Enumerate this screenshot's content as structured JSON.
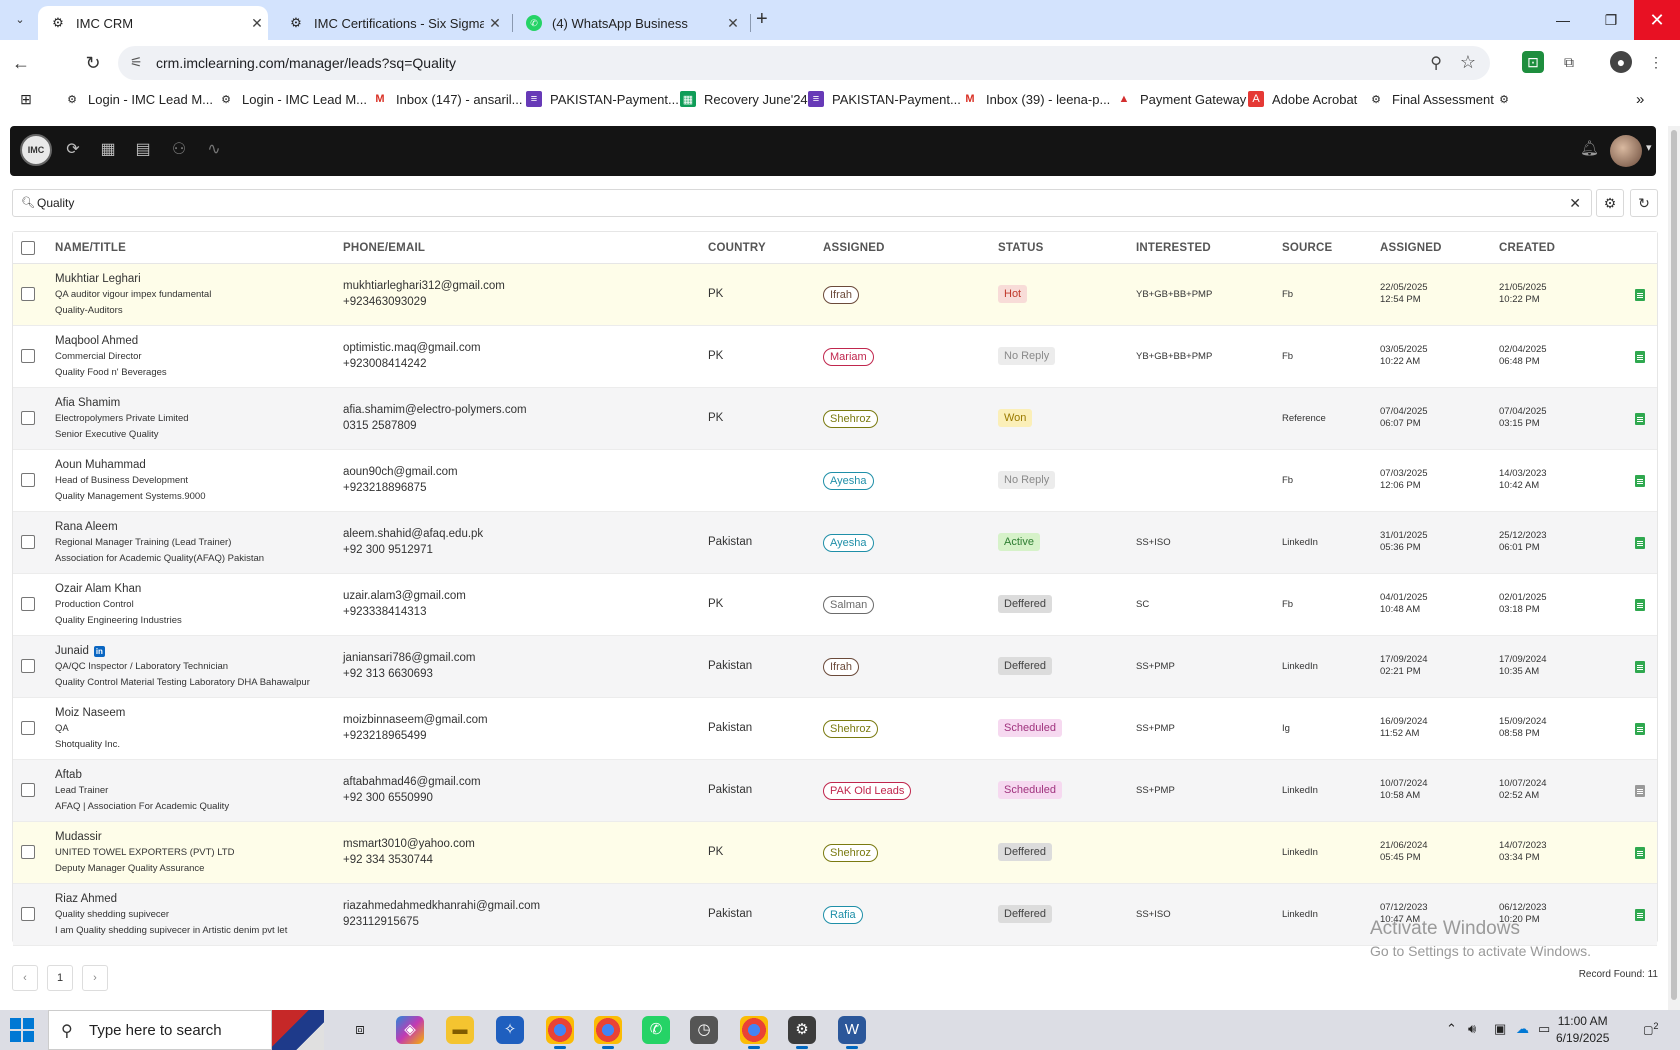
{
  "browser": {
    "tabs": [
      {
        "title": "IMC CRM",
        "active": true
      },
      {
        "title": "IMC Certifications - Six Sigma G",
        "active": false
      },
      {
        "title": "(4) WhatsApp Business",
        "active": false
      }
    ],
    "url": "crm.imclearning.com/manager/leads?sq=Quality",
    "bookmarks": [
      "Login - IMC Lead M...",
      "Login - IMC Lead M...",
      "Inbox (147) - ansaril...",
      "PAKISTAN-Payment...",
      "Recovery June'24",
      "PAKISTAN-Payment...",
      "Inbox (39) - leena-p...",
      "Payment Gateway",
      "Adobe Acrobat",
      "Final Assessment"
    ]
  },
  "search": {
    "value": "Quality"
  },
  "table": {
    "headers": [
      "NAME/TITLE",
      "PHONE/EMAIL",
      "COUNTRY",
      "ASSIGNED",
      "STATUS",
      "INTERESTED",
      "SOURCE",
      "ASSIGNED",
      "CREATED"
    ],
    "rows": [
      {
        "name": "Mukhtiar Leghari",
        "title": "QA auditor vigour impex fundamental",
        "company": "Quality-Auditors",
        "email": "mukhtiarleghari312@gmail.com",
        "phone": "+923463093029",
        "country": "PK",
        "assigned": "Ifrah",
        "status": "Hot",
        "interested": "YB+GB+BB+PMP",
        "source": "Fb",
        "assigned_date": "22/05/2025",
        "assigned_time": "12:54 PM",
        "created_date": "21/05/2025",
        "created_time": "10:22 PM"
      },
      {
        "name": "Maqbool Ahmed",
        "title": "Commercial Director",
        "company": "Quality Food n' Beverages",
        "email": "optimistic.maq@gmail.com",
        "phone": "+923008414242",
        "country": "PK",
        "assigned": "Mariam",
        "status": "No Reply",
        "interested": "YB+GB+BB+PMP",
        "source": "Fb",
        "assigned_date": "03/05/2025",
        "assigned_time": "10:22 AM",
        "created_date": "02/04/2025",
        "created_time": "06:48 PM"
      },
      {
        "name": "Afia Shamim",
        "title": "Electropolymers Private Limited",
        "company": "Senior Executive Quality",
        "email": "afia.shamim@electro-polymers.com",
        "phone": "0315 2587809",
        "country": "PK",
        "assigned": "Shehroz",
        "status": "Won",
        "interested": "",
        "source": "Reference",
        "assigned_date": "07/04/2025",
        "assigned_time": "06:07 PM",
        "created_date": "07/04/2025",
        "created_time": "03:15 PM"
      },
      {
        "name": "Aoun Muhammad",
        "title": "Head of Business Development",
        "company": "Quality Management Systems.9000",
        "email": "aoun90ch@gmail.com",
        "phone": "+923218896875",
        "country": "",
        "assigned": "Ayesha",
        "status": "No Reply",
        "interested": "",
        "source": "Fb",
        "assigned_date": "07/03/2025",
        "assigned_time": "12:06 PM",
        "created_date": "14/03/2023",
        "created_time": "10:42 AM"
      },
      {
        "name": "Rana Aleem",
        "title": "Regional Manager Training (Lead Trainer)",
        "company": "Association for Academic Quality(AFAQ) Pakistan",
        "email": "aleem.shahid@afaq.edu.pk",
        "phone": "+92 300 9512971",
        "country": "Pakistan",
        "assigned": "Ayesha",
        "status": "Active",
        "interested": "SS+ISO",
        "source": "LinkedIn",
        "assigned_date": "31/01/2025",
        "assigned_time": "05:36 PM",
        "created_date": "25/12/2023",
        "created_time": "06:01 PM"
      },
      {
        "name": "Ozair Alam Khan",
        "title": "Production Control",
        "company": "Quality Engineering Industries",
        "email": "uzair.alam3@gmail.com",
        "phone": "+923338414313",
        "country": "PK",
        "assigned": "Salman",
        "status": "Deffered",
        "interested": "SC",
        "source": "Fb",
        "assigned_date": "04/01/2025",
        "assigned_time": "10:48 AM",
        "created_date": "02/01/2025",
        "created_time": "03:18 PM"
      },
      {
        "name": "Junaid",
        "title": "QA/QC Inspector / Laboratory Technician",
        "company": "Quality Control Material Testing Laboratory DHA Bahawalpur",
        "email": "janiansari786@gmail.com",
        "phone": "+92 313 6630693",
        "country": "Pakistan",
        "assigned": "Ifrah",
        "status": "Deffered",
        "interested": "SS+PMP",
        "source": "LinkedIn",
        "assigned_date": "17/09/2024",
        "assigned_time": "02:21 PM",
        "created_date": "17/09/2024",
        "created_time": "10:35 AM"
      },
      {
        "name": "Moiz Naseem",
        "title": "QA",
        "company": "Shotquality Inc.",
        "email": "moizbinnaseem@gmail.com",
        "phone": "+923218965499",
        "country": "Pakistan",
        "assigned": "Shehroz",
        "status": "Scheduled",
        "interested": "SS+PMP",
        "source": "Ig",
        "assigned_date": "16/09/2024",
        "assigned_time": "11:52 AM",
        "created_date": "15/09/2024",
        "created_time": "08:58 PM"
      },
      {
        "name": "Aftab",
        "title": "Lead Trainer",
        "company": "AFAQ | Association For Academic Quality",
        "email": "aftabahmad46@gmail.com",
        "phone": "+92 300 6550990",
        "country": "Pakistan",
        "assigned": "PAK Old Leads",
        "status": "Scheduled",
        "interested": "SS+PMP",
        "source": "LinkedIn",
        "assigned_date": "10/07/2024",
        "assigned_time": "10:58 AM",
        "created_date": "10/07/2024",
        "created_time": "02:52 AM"
      },
      {
        "name": "Mudassir",
        "title": "UNITED TOWEL EXPORTERS (PVT) LTD",
        "company": "Deputy Manager Quality Assurance",
        "email": "msmart3010@yahoo.com",
        "phone": "+92 334 3530744",
        "country": "PK",
        "assigned": "Shehroz",
        "status": "Deffered",
        "interested": "",
        "source": "LinkedIn",
        "assigned_date": "21/06/2024",
        "assigned_time": "05:45 PM",
        "created_date": "14/07/2023",
        "created_time": "03:34 PM"
      },
      {
        "name": "Riaz Ahmed",
        "title": "Quality shedding supivecer",
        "company": "I am Quality shedding supivecer in Artistic denim pvt let",
        "email": "riazahmedahmedkhanrahi@gmail.com",
        "phone": "923112915675",
        "country": "Pakistan",
        "assigned": "Rafia",
        "status": "Deffered",
        "interested": "SS+ISO",
        "source": "LinkedIn",
        "assigned_date": "07/12/2023",
        "assigned_time": "10:47 AM",
        "created_date": "06/12/2023",
        "created_time": "10:20 PM"
      }
    ]
  },
  "pagination": {
    "prev": "‹",
    "page": "1",
    "next": "›"
  },
  "record_found": "Record Found: 11",
  "watermark": {
    "line1": "Activate Windows",
    "line2": "Go to Settings to activate Windows."
  },
  "taskbar": {
    "search_placeholder": "Type here to search",
    "time": "11:00 AM",
    "date": "6/19/2025",
    "notifications": "2"
  },
  "colors": {
    "assigned": {
      "Ifrah": "#6b4a3a",
      "Mariam": "#c0264d",
      "Shehroz": "#7a7a10",
      "Ayesha": "#1f8fa8",
      "Salman": "#6b6b6b",
      "PAK Old Leads": "#c0264d",
      "Rafia": "#1f8fa8"
    },
    "status_bg": {
      "Hot": "#f8dcd8",
      "No Reply": "#ececec",
      "Won": "#fbefb8",
      "Active": "#d6f2c9",
      "Deffered": "#dcdcdc",
      "Scheduled": "#f6d9f0"
    },
    "status_fg": {
      "Hot": "#c0392b",
      "No Reply": "#8a8a8a",
      "Won": "#9a7a00",
      "Active": "#2e7d32",
      "Deffered": "#444444",
      "Scheduled": "#a0337e"
    },
    "doc_green": "#2fa84f",
    "doc_gray": "#9a9a9a"
  }
}
